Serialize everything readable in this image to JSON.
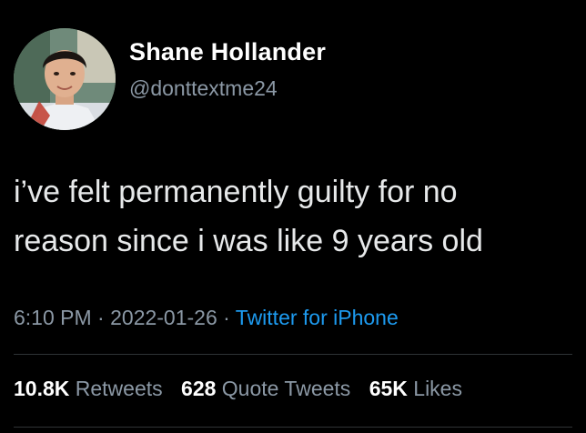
{
  "author": {
    "display_name": "Shane Hollander",
    "handle": "@donttextme24"
  },
  "tweet": {
    "text": "i’ve felt permanently guilty for no\nreason since i was like 9 years old"
  },
  "meta": {
    "time": "6:10 PM",
    "separator": " · ",
    "date": "2022-01-26",
    "source": "Twitter for iPhone"
  },
  "stats": {
    "retweets_count": "10.8K",
    "retweets_label": "Retweets",
    "quotes_count": "628",
    "quotes_label": "Quote Tweets",
    "likes_count": "65K",
    "likes_label": "Likes"
  },
  "colors": {
    "background": "#000000",
    "primary_text": "#e7e9ea",
    "secondary_text": "#8b98a5",
    "accent": "#1d9bf0"
  }
}
